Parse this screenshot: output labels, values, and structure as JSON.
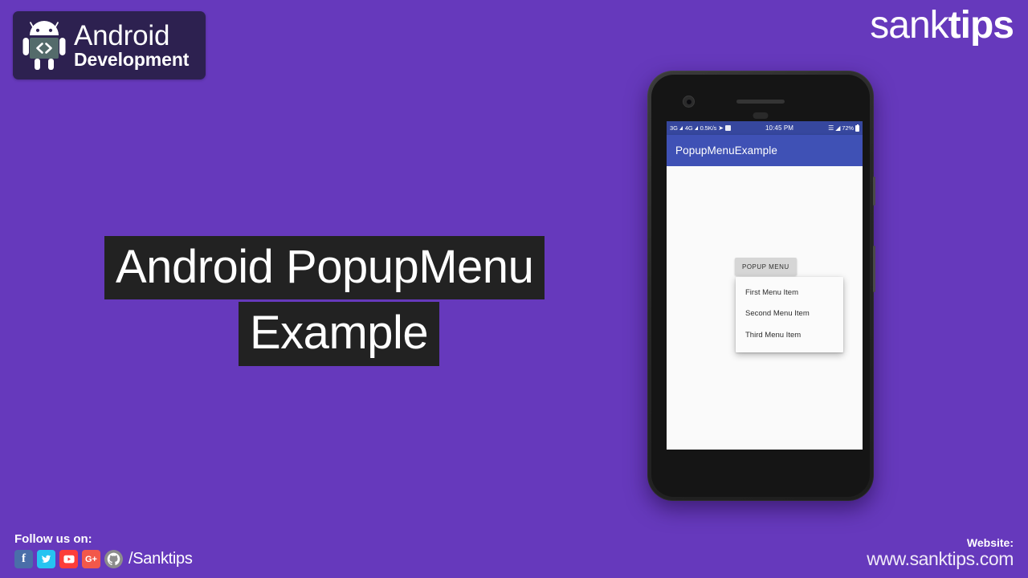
{
  "background_color": "#6639bc",
  "brand_badge": {
    "icon": "android-robot-code-icon",
    "line1": "Android",
    "line2": "Development",
    "background_color": "#2d2150"
  },
  "site_logo": {
    "light_part": "sank",
    "bold_part": "tips"
  },
  "headline": {
    "line1": "Android PopupMenu",
    "line2": "Example",
    "background_color": "#222222",
    "text_color": "#ffffff"
  },
  "phone": {
    "screen": {
      "statusbar": {
        "network_3g": "3G",
        "network_4g": "4G",
        "data_rate": "0.5K/s",
        "location_icon": "location-arrow-icon",
        "photo_icon": "photo-icon",
        "time": "10:45 PM",
        "signal_icon": "signal-bars-icon",
        "wifi_icon": "wifi-icon",
        "battery_percent": "72%",
        "battery_icon": "battery-icon",
        "background_color": "#36479e"
      },
      "appbar": {
        "title": "PopupMenuExample",
        "background_color": "#3f51b5"
      },
      "popup_button": {
        "label": "POPUP MENU",
        "background_color": "#d6d6d6"
      },
      "popup_menu": {
        "items": [
          {
            "label": "First Menu Item"
          },
          {
            "label": "Second Menu Item"
          },
          {
            "label": "Third Menu Item"
          }
        ],
        "background_color": "#fbfbfb"
      }
    }
  },
  "footer": {
    "follow_label": "Follow us on:",
    "social": [
      {
        "name": "facebook",
        "glyph": "f"
      },
      {
        "name": "twitter",
        "glyph": "✆"
      },
      {
        "name": "youtube",
        "glyph": "▶"
      },
      {
        "name": "googleplus",
        "glyph": "G+"
      },
      {
        "name": "github",
        "glyph": "◉"
      }
    ],
    "handle": "/Sanktips",
    "website_label": "Website:",
    "website_url": "www.sanktips.com"
  }
}
